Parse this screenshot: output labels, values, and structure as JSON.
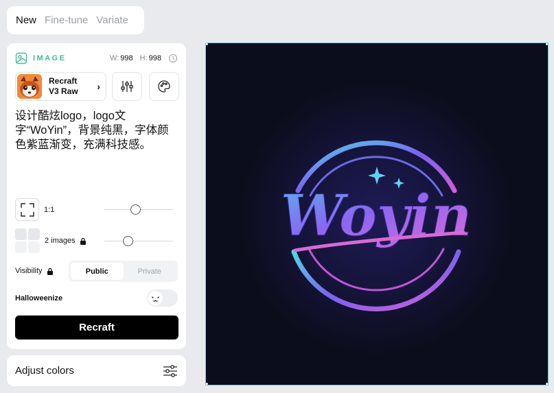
{
  "tabs": [
    {
      "label": "New",
      "active": true
    },
    {
      "label": "Fine-tune",
      "active": false
    },
    {
      "label": "Variate",
      "active": false
    }
  ],
  "image_panel": {
    "section_title": "IMAGE",
    "width_key": "W:",
    "width_value": "998",
    "height_key": "H:",
    "height_value": "998",
    "model": {
      "line1": "Recraft",
      "line2": "V3 Raw"
    },
    "prompt": "设计酷炫logo，logo文字“WoYin”，背景纯黑，字体颜色紫蓝渐变，充满科技感。",
    "aspect_ratio": {
      "label": "1:1",
      "level": 0.45
    },
    "images": {
      "label": "2 images",
      "level": 0.32
    },
    "visibility": {
      "label": "Visibility",
      "options": [
        "Public",
        "Private"
      ],
      "selected": "Public"
    },
    "halloweenize": {
      "label": "Halloweenize",
      "enabled": false
    },
    "cta_label": "Recraft"
  },
  "adjust_colors": {
    "label": "Adjust colors"
  },
  "canvas": {
    "logo_text": "Woyin",
    "background": "#0c0d1c",
    "gradient": [
      "#4fd8e8",
      "#7a62f0",
      "#d35ed6"
    ]
  },
  "colors": {
    "accent": "#3dbf93",
    "selection": "#6bc9d8"
  }
}
